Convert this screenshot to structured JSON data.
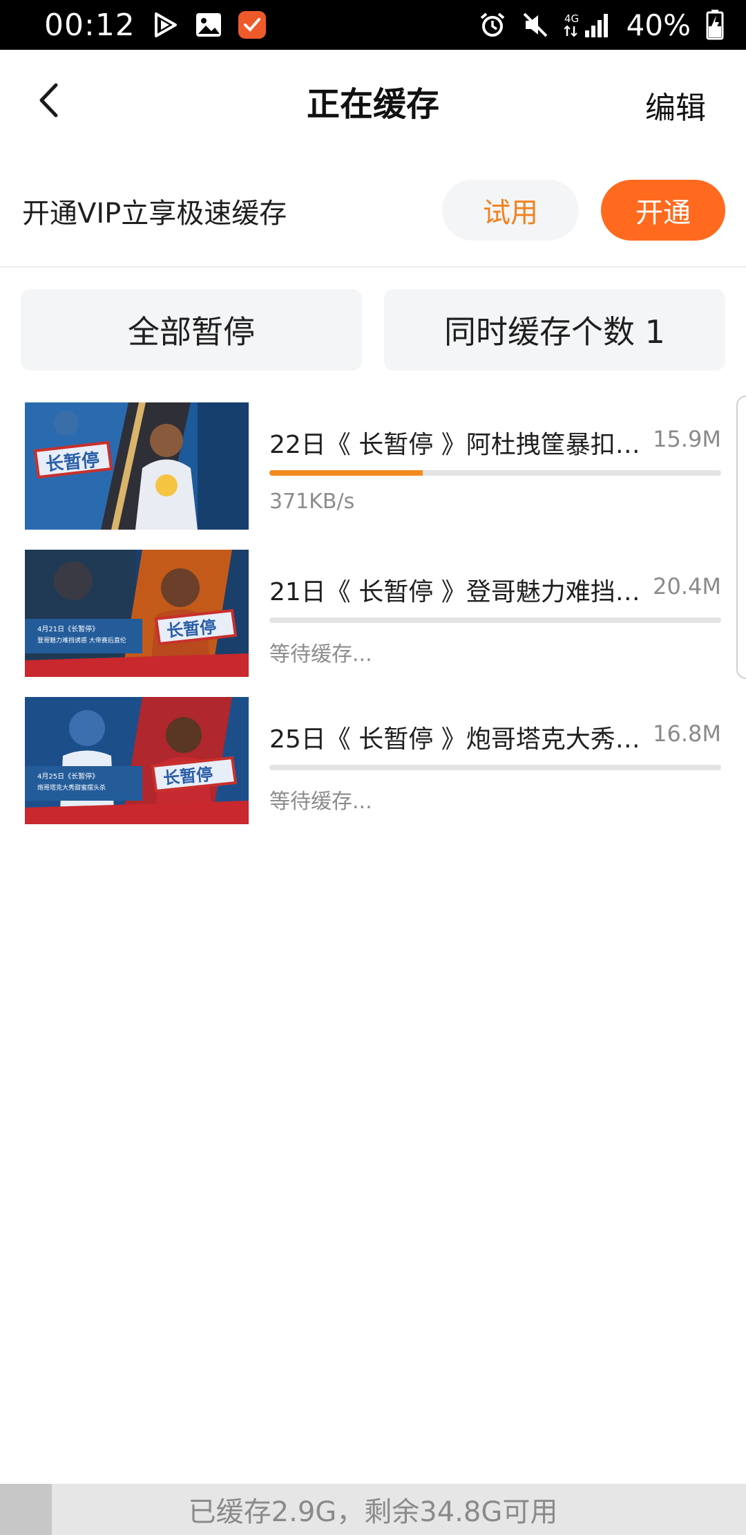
{
  "status_bar": {
    "time": "00:12",
    "battery_percent": "40%",
    "network": "4G",
    "icons": [
      "play-icon",
      "gallery-icon",
      "notification-app-icon",
      "alarm-icon",
      "mute-icon",
      "signal-icon",
      "battery-icon"
    ]
  },
  "nav": {
    "title": "正在缓存",
    "edit_label": "编辑"
  },
  "vip": {
    "text": "开通VIP立享极速缓存",
    "try_label": "试用",
    "open_label": "开通",
    "accent_color": "#ff6a1f",
    "try_color": "#f0821e"
  },
  "actions": {
    "pause_all_label": "全部暂停",
    "concurrent_label": "同时缓存个数 1"
  },
  "downloads": [
    {
      "title": "22日《 长暂停 》阿杜拽筐暴扣吓...",
      "size": "15.9M",
      "status": "371KB/s",
      "progress": 0.34,
      "thumb_text": "长暂停"
    },
    {
      "title": "21日《 长暂停 》登哥魅力难挡诱...",
      "size": "20.4M",
      "status": "等待缓存...",
      "progress": 0,
      "thumb_text": "长暂停",
      "thumb_caption_1": "4月21日《长暂停》",
      "thumb_caption_2": "登哥魅力难挡诱惑 大帝赛后直伦"
    },
    {
      "title": "25日《 长暂停 》炮哥塔克大秀甜...",
      "size": "16.8M",
      "status": "等待缓存...",
      "progress": 0,
      "thumb_text": "长暂停",
      "thumb_caption_1": "4月25日《长暂停》",
      "thumb_caption_2": "炮哥塔克大秀甜蜜摆头杀"
    }
  ],
  "storage": {
    "text": "已缓存2.9G，剩余34.8G可用"
  }
}
